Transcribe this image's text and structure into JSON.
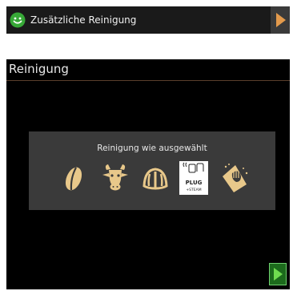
{
  "topbar": {
    "title": "Zusätzliche Reinigung",
    "smile_icon": "smile-icon",
    "next_icon": "arrow-right-icon"
  },
  "screen": {
    "heading": "Reinigung",
    "panel_title": "Reinigung wie ausgewählt",
    "icons": [
      "coffee-bean-icon",
      "cow-milk-icon",
      "steam-wand-icon",
      "plug-steam-icon",
      "cleaning-cloth-icon"
    ],
    "plug_label": "PLUG",
    "plug_sublabel": "+STEAM"
  },
  "play_icon": "play-icon",
  "colors": {
    "accent_green": "#2e9a2e",
    "accent_orange": "#e39a4c",
    "icon_gold": "#e8c88a"
  }
}
